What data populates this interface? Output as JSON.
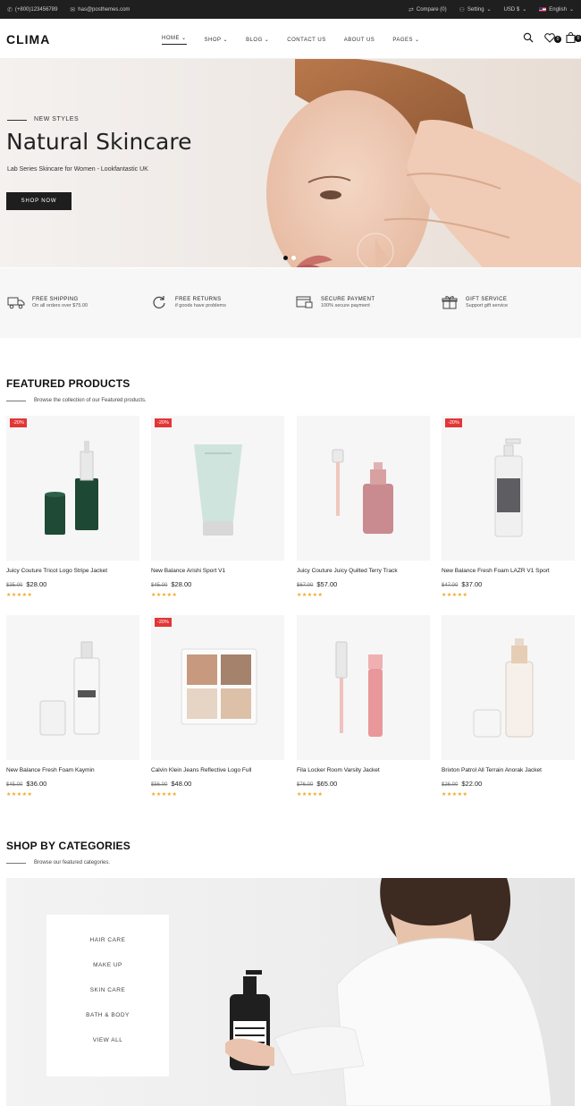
{
  "topbar": {
    "phone": "(+800)123456789",
    "email": "has@posthemes.com",
    "compare": "Compare (0)",
    "setting": "Setting",
    "currency": "USD $",
    "language": "English"
  },
  "header": {
    "logo": "CLIMA",
    "nav": [
      "HOME",
      "SHOP",
      "BLOG",
      "CONTACT US",
      "ABOUT US",
      "PAGES"
    ],
    "wishlist_count": "0",
    "cart_count": "0"
  },
  "hero": {
    "eyebrow": "NEW STYLES",
    "title": "Natural Skincare",
    "description": "Lab Series Skincare for Women - Lookfantastic UK",
    "button": "SHOP NOW"
  },
  "features": [
    {
      "icon": "truck-icon",
      "title": "FREE SHIPPING",
      "subtitle": "On all orders over $75.00"
    },
    {
      "icon": "refresh-icon",
      "title": "FREE RETURNS",
      "subtitle": "if goods have problems"
    },
    {
      "icon": "secure-card-icon",
      "title": "SECURE PAYMENT",
      "subtitle": "100% secure payment"
    },
    {
      "icon": "gift-icon",
      "title": "GIFT SERVICE",
      "subtitle": "Support gift service"
    }
  ],
  "featured": {
    "title": "FEATURED PRODUCTS",
    "subtitle": "Browse the collection of our Featured products.",
    "products": [
      {
        "name": "Juicy Couture Tricot Logo Stripe Jacket",
        "old": "$35.00",
        "price": "$28.00",
        "sale": "-20%"
      },
      {
        "name": "New Balance Arishi Sport V1",
        "old": "$45.00",
        "price": "$28.00",
        "sale": "-20%"
      },
      {
        "name": "Juicy Couture Juicy Quilted Terry Track",
        "old": "$67.00",
        "price": "$57.00",
        "sale": ""
      },
      {
        "name": "New Balance Fresh Foam LAZR V1 Sport",
        "old": "$47.00",
        "price": "$37.00",
        "sale": "-20%"
      },
      {
        "name": "New Balance Fresh Foam Kaymin",
        "old": "$45.00",
        "price": "$36.00",
        "sale": ""
      },
      {
        "name": "Calvin Klein Jeans Reflective Logo Full",
        "old": "$56.00",
        "price": "$48.00",
        "sale": "-20%"
      },
      {
        "name": "Fila Locker Room Varsity Jacket",
        "old": "$76.00",
        "price": "$65.00",
        "sale": ""
      },
      {
        "name": "Brixton Patrol All Terrain Anorak Jacket",
        "old": "$26.00",
        "price": "$22.00",
        "sale": ""
      }
    ],
    "stars": "★★★★★"
  },
  "categories": {
    "title": "SHOP BY CATEGORIES",
    "subtitle": "Browse our featured categories.",
    "items": [
      "HAIR CARE",
      "MAKE UP",
      "SKIN CARE",
      "BATH & BODY",
      "VIEW ALL"
    ]
  },
  "colors": {
    "accent": "#1e1e1e",
    "sale": "#e23636",
    "star": "#f0a828"
  }
}
